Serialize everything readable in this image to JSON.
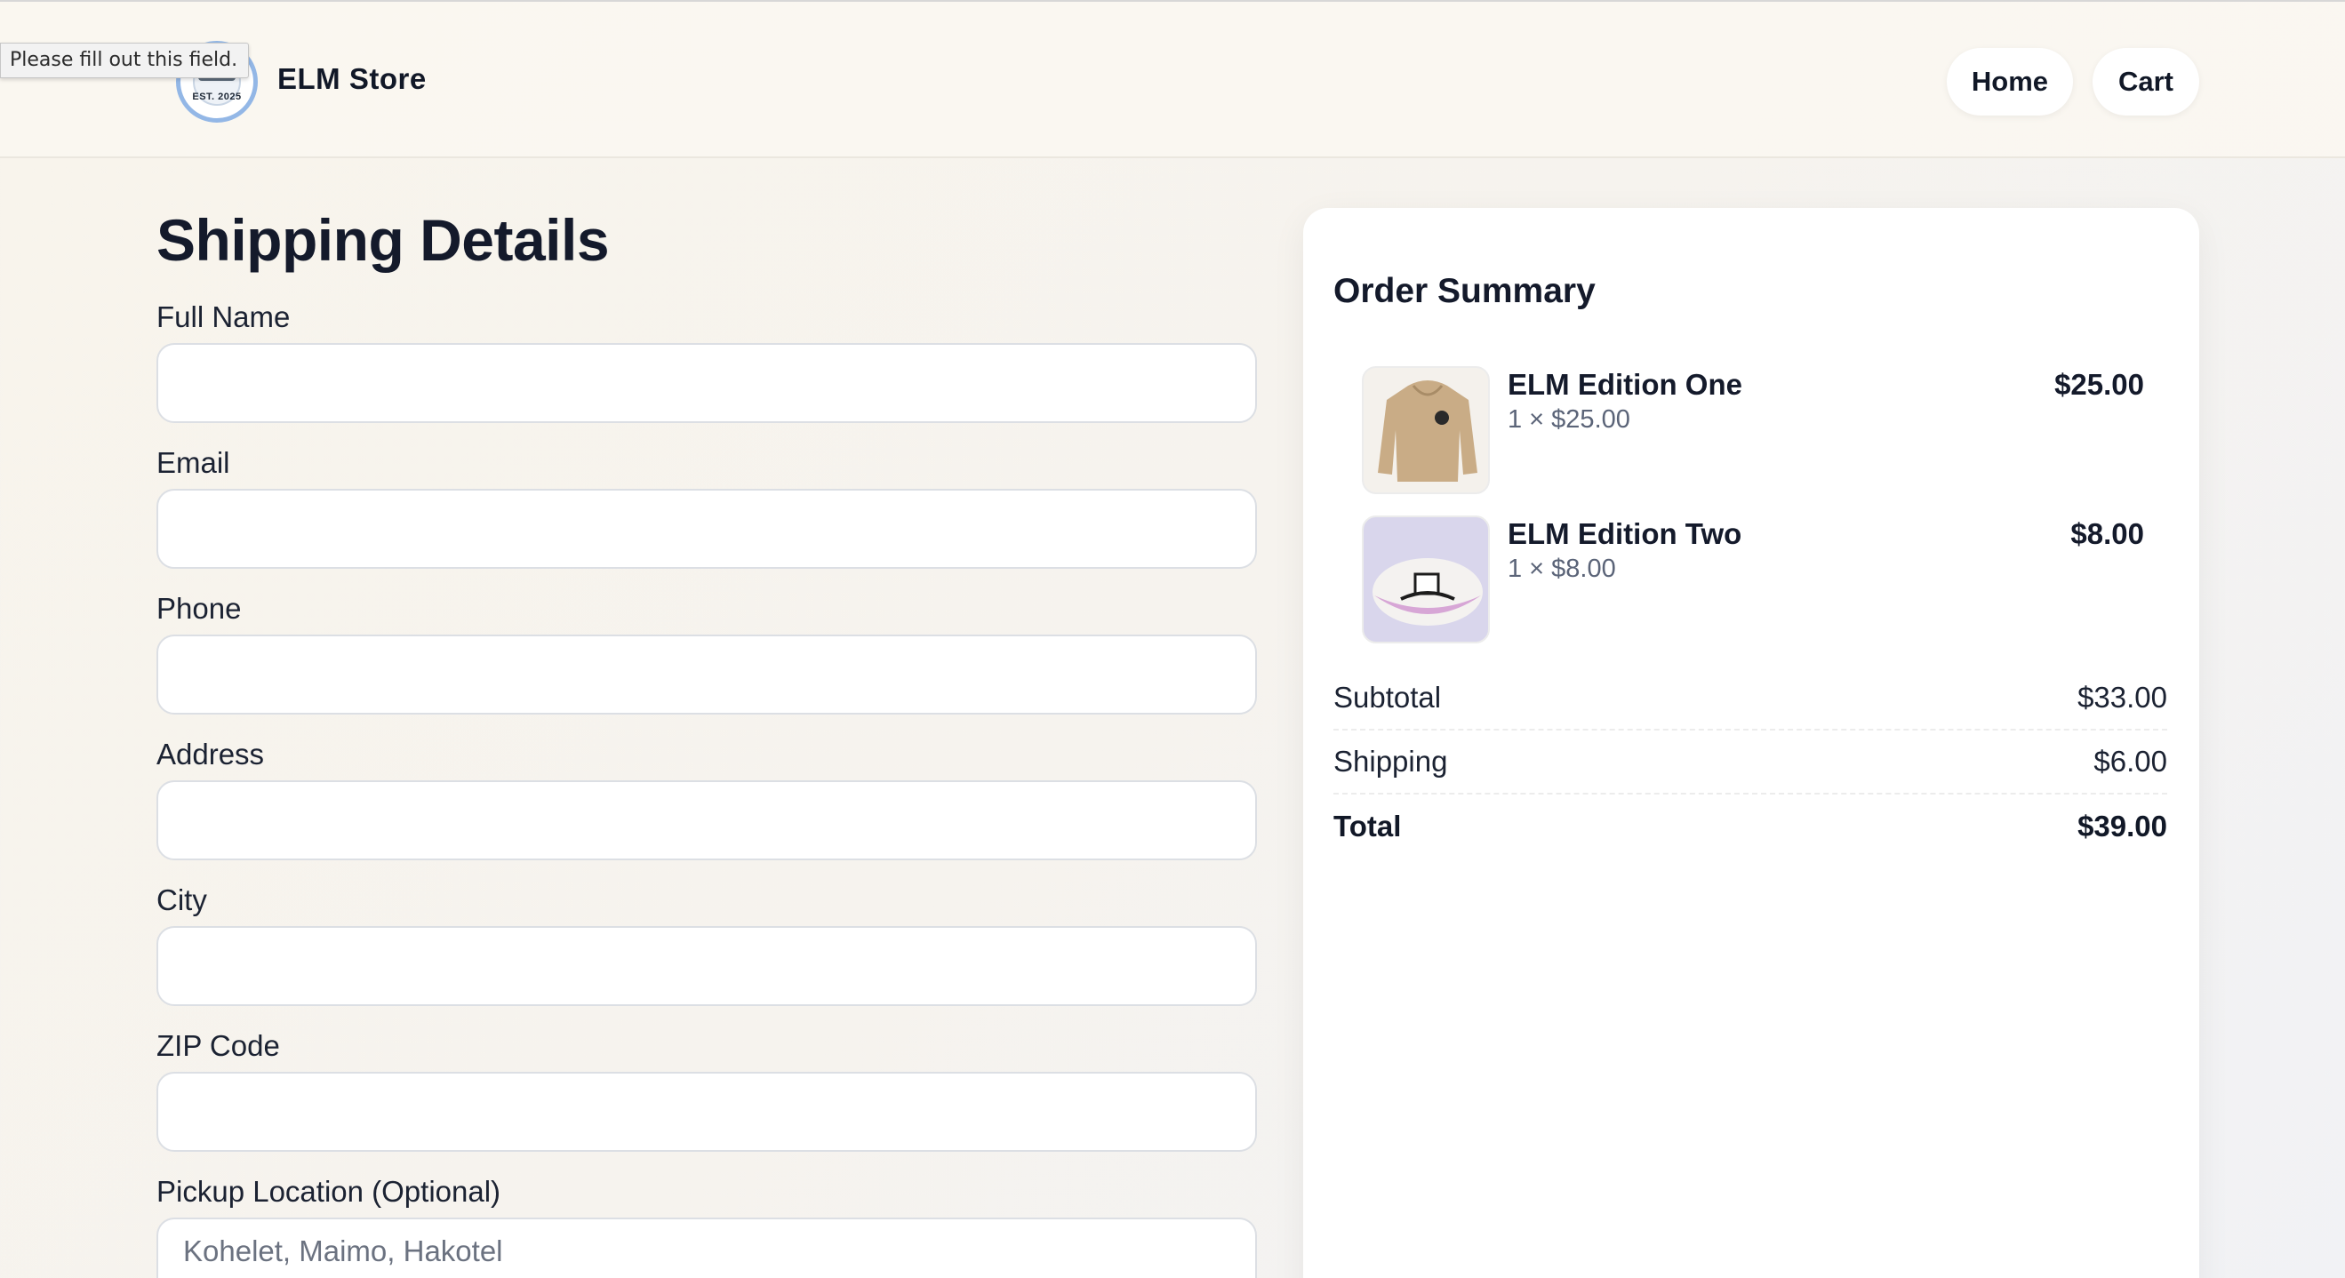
{
  "tooltip": "Please fill out this field.",
  "header": {
    "logo_text": "EST. 2025",
    "brand": "ELM Store",
    "nav": {
      "home": "Home",
      "cart": "Cart"
    }
  },
  "form": {
    "title": "Shipping Details",
    "fields": [
      {
        "label": "Full Name",
        "value": "",
        "placeholder": ""
      },
      {
        "label": "Email",
        "value": "",
        "placeholder": ""
      },
      {
        "label": "Phone",
        "value": "",
        "placeholder": ""
      },
      {
        "label": "Address",
        "value": "",
        "placeholder": ""
      },
      {
        "label": "City",
        "value": "",
        "placeholder": ""
      },
      {
        "label": "ZIP Code",
        "value": "",
        "placeholder": ""
      },
      {
        "label": "Pickup Location (Optional)",
        "value": "",
        "placeholder": "Kohelet, Maimo, Hakotel"
      }
    ]
  },
  "summary": {
    "title": "Order Summary",
    "items": [
      {
        "name": "ELM Edition One",
        "qty": "1 × $25.00",
        "price": "$25.00",
        "image": "hoodie-image"
      },
      {
        "name": "ELM Edition Two",
        "qty": "1 × $8.00",
        "price": "$8.00",
        "image": "kippah-image"
      }
    ],
    "subtotal_label": "Subtotal",
    "subtotal": "$33.00",
    "shipping_label": "Shipping",
    "shipping": "$6.00",
    "total_label": "Total",
    "total": "$39.00"
  }
}
